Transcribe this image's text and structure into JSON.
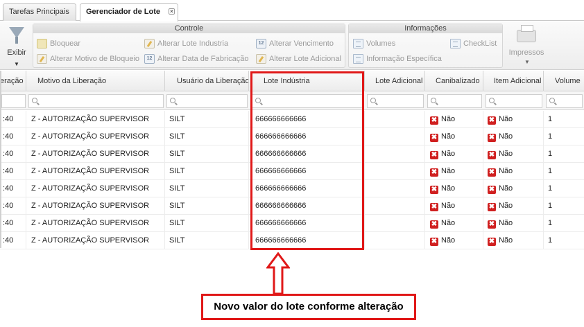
{
  "tabs": [
    {
      "label": "Tarefas Principais"
    },
    {
      "label": "Gerenciador de Lote"
    }
  ],
  "toolbar": {
    "exibir": "Exibir",
    "controle": {
      "title": "Controle",
      "buttons": [
        "Bloquear",
        "Alterar Lote Industria",
        "Alterar Vencimento",
        "Alterar Motivo de Bloqueio",
        "Alterar Data de Fabricação",
        "Alterar Lote Adicional"
      ]
    },
    "informacoes": {
      "title": "Informações",
      "buttons": [
        "Volumes",
        "CheckList",
        "Informação Específica"
      ]
    },
    "impressos": "Impressos"
  },
  "grid": {
    "columns": [
      "eração",
      "Motivo da Liberação",
      "Usuário da Liberação",
      "Lote Indústria",
      "Lote Adicional",
      "Canibalizado",
      "Item Adicional",
      "Volume"
    ],
    "rows": [
      [
        ":40",
        "Z - AUTORIZAÇÃO SUPERVISOR",
        "SILT",
        "666666666666",
        "",
        "Não",
        "Não",
        "1"
      ],
      [
        ":40",
        "Z - AUTORIZAÇÃO SUPERVISOR",
        "SILT",
        "666666666666",
        "",
        "Não",
        "Não",
        "1"
      ],
      [
        ":40",
        "Z - AUTORIZAÇÃO SUPERVISOR",
        "SILT",
        "666666666666",
        "",
        "Não",
        "Não",
        "1"
      ],
      [
        ":40",
        "Z - AUTORIZAÇÃO SUPERVISOR",
        "SILT",
        "666666666666",
        "",
        "Não",
        "Não",
        "1"
      ],
      [
        ":40",
        "Z - AUTORIZAÇÃO SUPERVISOR",
        "SILT",
        "666666666666",
        "",
        "Não",
        "Não",
        "1"
      ],
      [
        ":40",
        "Z - AUTORIZAÇÃO SUPERVISOR",
        "SILT",
        "666666666666",
        "",
        "Não",
        "Não",
        "1"
      ],
      [
        ":40",
        "Z - AUTORIZAÇÃO SUPERVISOR",
        "SILT",
        "666666666666",
        "",
        "Não",
        "Não",
        "1"
      ],
      [
        ":40",
        "Z - AUTORIZAÇÃO SUPERVISOR",
        "SILT",
        "666666666666",
        "",
        "Não",
        "Não",
        "1"
      ]
    ]
  },
  "annotation": {
    "text": "Novo valor do lote conforme alteração",
    "color": "#e01818"
  }
}
